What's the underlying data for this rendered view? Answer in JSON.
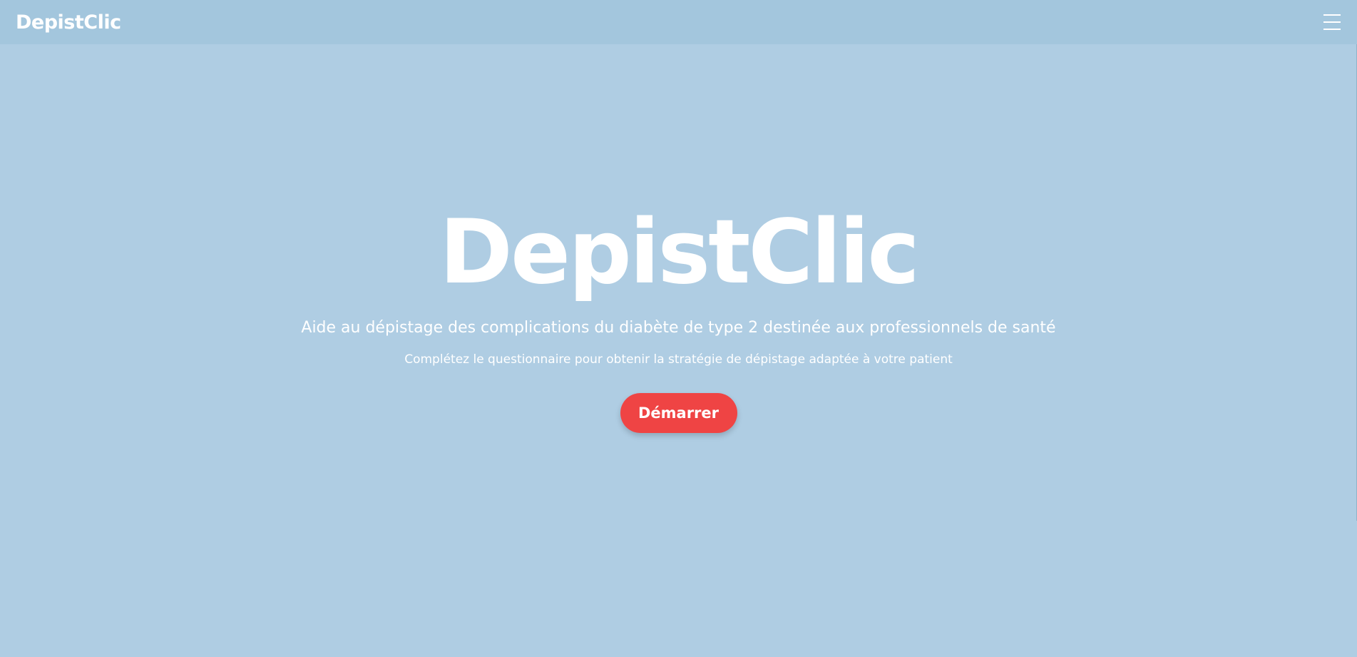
{
  "navbar": {
    "brand": "DepistClic",
    "menu_icon": "hamburger-menu-icon"
  },
  "hero": {
    "title": "DepistClic",
    "subtitle": "Aide au dépistage des complications du diabète de type 2 destinée aux professionnels de santé",
    "text": "Complétez le questionnaire pour obtenir la stratégie de dépistage adaptée à votre patient",
    "start_button_label": "Démarrer"
  },
  "colors": {
    "page_background": "#afcde3",
    "navbar_background": "#a3c6dd",
    "text": "#ffffff",
    "primary_button": "#ef4444"
  }
}
